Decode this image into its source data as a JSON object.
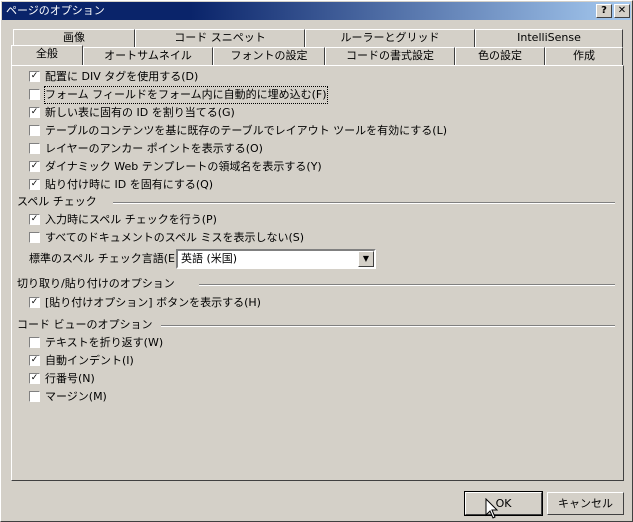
{
  "window": {
    "title": "ページのオプション",
    "help_label": "?",
    "close_label": "✕"
  },
  "tabs_row1": [
    "画像",
    "コード スニペット",
    "ルーラーとグリッド",
    "IntelliSense"
  ],
  "tabs_row2": [
    "全般",
    "オートサムネイル",
    "フォントの設定",
    "コードの書式設定",
    "色の設定",
    "作成"
  ],
  "general": {
    "options": [
      {
        "label": "配置に DIV タグを使用する(D)",
        "checked": true
      },
      {
        "label": "フォーム フィールドをフォーム内に自動的に埋め込む(F)",
        "checked": false
      },
      {
        "label": "新しい表に固有の ID を割り当てる(G)",
        "checked": true
      },
      {
        "label": "テーブルのコンテンツを基に既存のテーブルでレイアウト ツールを有効にする(L)",
        "checked": false
      },
      {
        "label": "レイヤーのアンカー ポイントを表示する(O)",
        "checked": false
      },
      {
        "label": "ダイナミック Web テンプレートの領域名を表示する(Y)",
        "checked": true
      },
      {
        "label": "貼り付け時に ID を固有にする(Q)",
        "checked": true
      }
    ]
  },
  "spell": {
    "heading": "スペル チェック",
    "options": [
      {
        "label": "入力時にスペル チェックを行う(P)",
        "checked": true
      },
      {
        "label": "すべてのドキュメントのスペル ミスを表示しない(S)",
        "checked": false
      }
    ],
    "language_label": "標準のスペル チェック言語(E):",
    "language_value": "英語 (米国)"
  },
  "paste": {
    "heading": "切り取り/貼り付けのオプション",
    "options": [
      {
        "label": "[貼り付けオプション] ボタンを表示する(H)",
        "checked": true
      }
    ]
  },
  "code_view": {
    "heading": "コード ビューのオプション",
    "options": [
      {
        "label": "テキストを折り返す(W)",
        "checked": false
      },
      {
        "label": "自動インデント(I)",
        "checked": true
      },
      {
        "label": "行番号(N)",
        "checked": true
      },
      {
        "label": "マージン(M)",
        "checked": false
      }
    ]
  },
  "buttons": {
    "ok": "OK",
    "cancel": "キャンセル"
  }
}
